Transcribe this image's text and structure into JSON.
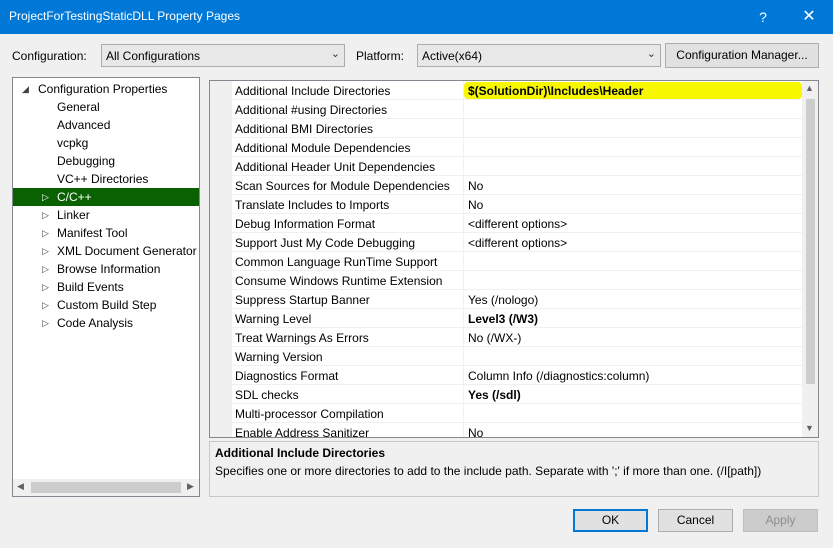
{
  "window": {
    "title": "ProjectForTestingStaticDLL Property Pages",
    "help_glyph": "?",
    "close_glyph": "✕"
  },
  "config": {
    "configuration_label": "Configuration:",
    "configuration_value": "All Configurations",
    "platform_label": "Platform:",
    "platform_value": "Active(x64)",
    "manager_button": "Configuration Manager..."
  },
  "tree": {
    "root": "Configuration Properties",
    "items": [
      {
        "label": "General",
        "expandable": false
      },
      {
        "label": "Advanced",
        "expandable": false
      },
      {
        "label": "vcpkg",
        "expandable": false
      },
      {
        "label": "Debugging",
        "expandable": false
      },
      {
        "label": "VC++ Directories",
        "expandable": false
      },
      {
        "label": "C/C++",
        "expandable": true,
        "selected": true
      },
      {
        "label": "Linker",
        "expandable": true
      },
      {
        "label": "Manifest Tool",
        "expandable": true
      },
      {
        "label": "XML Document Generator",
        "expandable": true
      },
      {
        "label": "Browse Information",
        "expandable": true
      },
      {
        "label": "Build Events",
        "expandable": true
      },
      {
        "label": "Custom Build Step",
        "expandable": true
      },
      {
        "label": "Code Analysis",
        "expandable": true
      }
    ]
  },
  "properties": [
    {
      "name": "Additional Include Directories",
      "value": "$(SolutionDir)\\Includes\\Header",
      "bold": true,
      "highlight": true
    },
    {
      "name": "Additional #using Directories",
      "value": ""
    },
    {
      "name": "Additional BMI Directories",
      "value": ""
    },
    {
      "name": "Additional Module Dependencies",
      "value": ""
    },
    {
      "name": "Additional Header Unit Dependencies",
      "value": ""
    },
    {
      "name": "Scan Sources for Module Dependencies",
      "value": "No"
    },
    {
      "name": "Translate Includes to Imports",
      "value": "No"
    },
    {
      "name": "Debug Information Format",
      "value": "<different options>"
    },
    {
      "name": "Support Just My Code Debugging",
      "value": "<different options>"
    },
    {
      "name": "Common Language RunTime Support",
      "value": ""
    },
    {
      "name": "Consume Windows Runtime Extension",
      "value": ""
    },
    {
      "name": "Suppress Startup Banner",
      "value": "Yes (/nologo)"
    },
    {
      "name": "Warning Level",
      "value": "Level3 (/W3)",
      "bold": true
    },
    {
      "name": "Treat Warnings As Errors",
      "value": "No (/WX-)"
    },
    {
      "name": "Warning Version",
      "value": ""
    },
    {
      "name": "Diagnostics Format",
      "value": "Column Info (/diagnostics:column)"
    },
    {
      "name": "SDL checks",
      "value": "Yes (/sdl)",
      "bold": true
    },
    {
      "name": "Multi-processor Compilation",
      "value": ""
    },
    {
      "name": "Enable Address Sanitizer",
      "value": "No"
    }
  ],
  "description": {
    "title": "Additional Include Directories",
    "text": "Specifies one or more directories to add to the include path. Separate with ';' if more than one.     (/I[path])"
  },
  "buttons": {
    "ok": "OK",
    "cancel": "Cancel",
    "apply": "Apply"
  },
  "colors": {
    "titlebar": "#0078d7",
    "tree_selected": "#0a6102",
    "highlight": "#f7f700"
  }
}
